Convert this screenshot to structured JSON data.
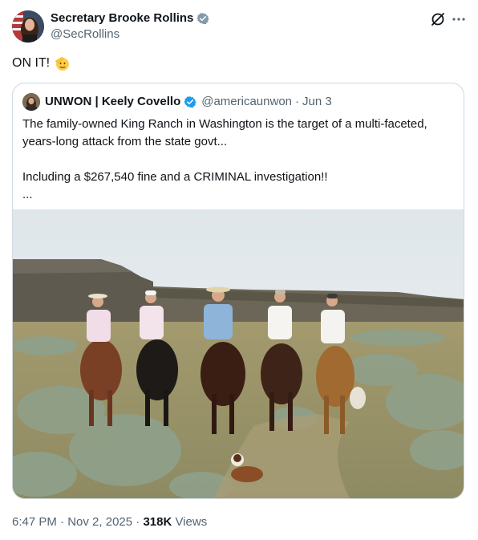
{
  "author": {
    "name": "Secretary Brooke Rollins",
    "handle": "@SecRollins"
  },
  "tweet": {
    "text": "ON IT!",
    "emoji": "saluting-face"
  },
  "quoted_tweet": {
    "name": "UNWON | Keely Covello",
    "handle": "@americaunwon",
    "separator": "·",
    "date": "Jun 3",
    "lines": [
      "The family-owned King Ranch in Washington is the target of a multi-faceted, years-long attack from the state govt...",
      "Including a $267,540 fine and a CRIMINAL investigation!!",
      "..."
    ],
    "photo": "ranch-riders-photo"
  },
  "meta": {
    "time": "6:47 PM",
    "dot1": "·",
    "date": "Nov 2, 2025",
    "dot2": "·",
    "views_count": "318K",
    "views_label": "Views"
  },
  "colors": {
    "verified": "#1d9bf0",
    "secondary_text": "#536471",
    "border": "#cfd9de"
  }
}
